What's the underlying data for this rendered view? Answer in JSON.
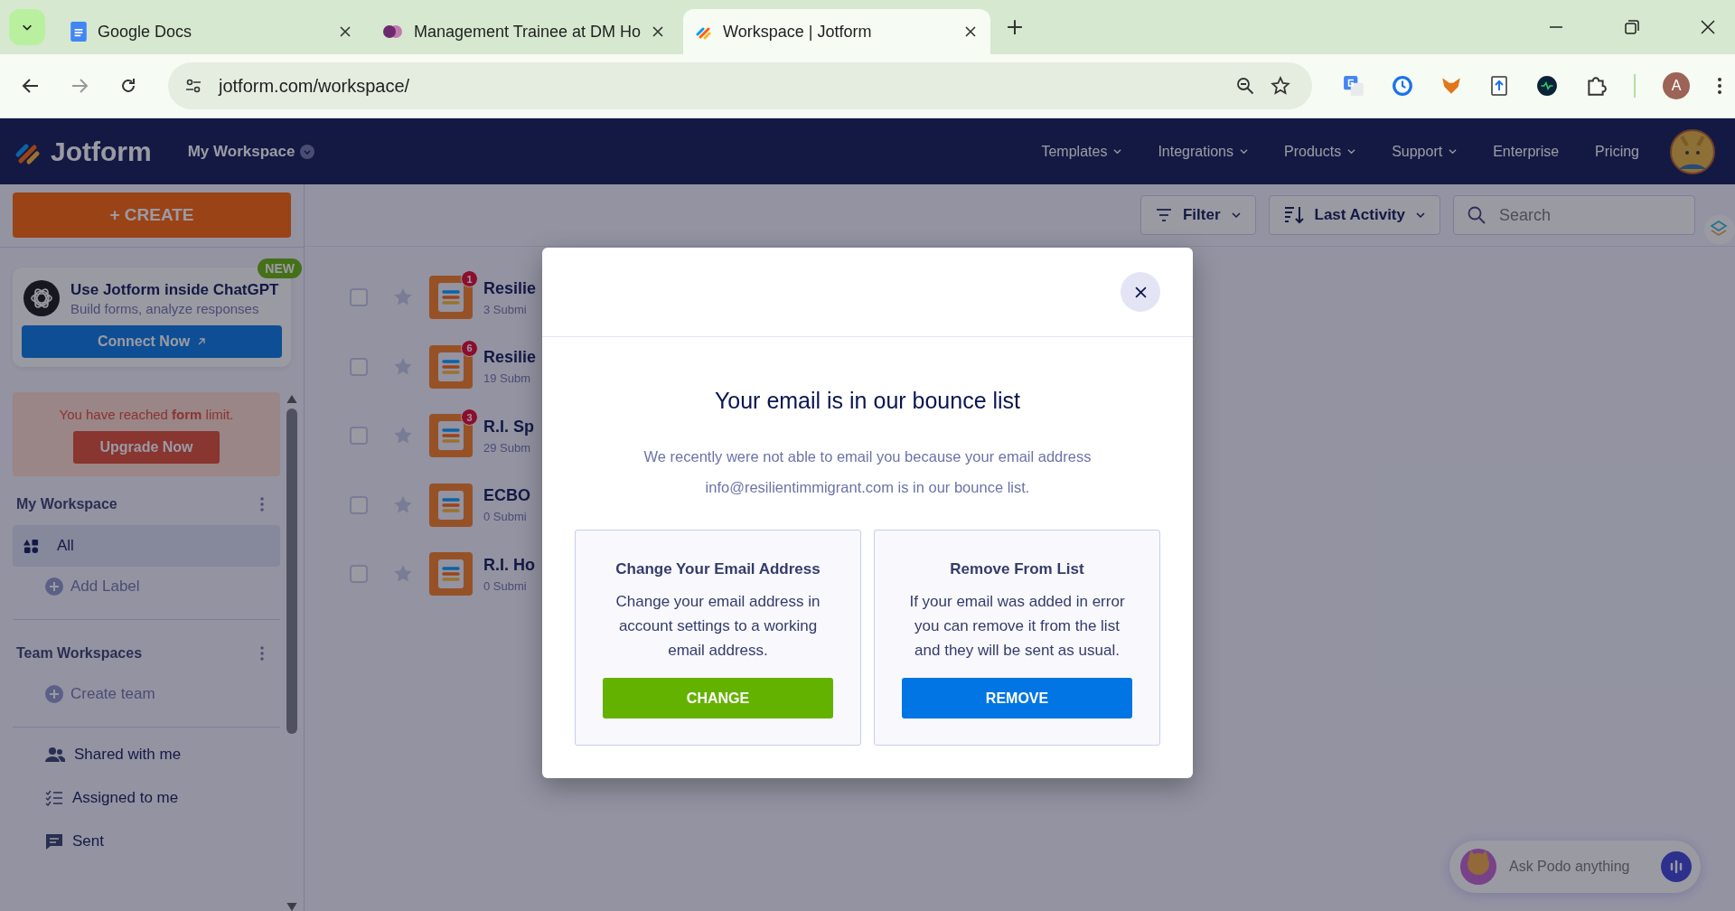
{
  "browser": {
    "tabs": [
      {
        "title": "Google Docs",
        "kind": "docs",
        "selected": false
      },
      {
        "title": "Management Trainee at DM Ho",
        "kind": "teams",
        "selected": false
      },
      {
        "title": "Workspace | Jotform",
        "kind": "jotform",
        "selected": true
      }
    ],
    "address": "jotform.com/workspace/",
    "profile_initial": "A"
  },
  "header": {
    "logo": "Jotform",
    "workspace": "My Workspace",
    "nav": [
      {
        "label": "Templates",
        "has_menu": true
      },
      {
        "label": "Integrations",
        "has_menu": true
      },
      {
        "label": "Products",
        "has_menu": true
      },
      {
        "label": "Support",
        "has_menu": true
      },
      {
        "label": "Enterprise",
        "has_menu": false
      },
      {
        "label": "Pricing",
        "has_menu": false
      }
    ]
  },
  "sidebar": {
    "create_button": "+ CREATE",
    "promo": {
      "badge": "NEW",
      "title": "Use Jotform inside ChatGPT",
      "subtitle": "Build forms, analyze responses",
      "button": "Connect Now"
    },
    "limit": {
      "message": "You have reached **form** limit.",
      "button": "Upgrade Now"
    },
    "my_workspace": {
      "title": "My Workspace",
      "items": [
        {
          "label": "All",
          "selected": true
        }
      ],
      "add_label": "Add Label"
    },
    "team_workspaces": {
      "title": "Team Workspaces",
      "create": "Create team"
    },
    "links": [
      {
        "label": "Shared with me",
        "kind": "shared"
      },
      {
        "label": "Assigned to me",
        "kind": "assigned"
      },
      {
        "label": "Sent",
        "kind": "sent"
      }
    ]
  },
  "toolbar": {
    "filter": "Filter",
    "sort": "Last Activity",
    "search_placeholder": "Search"
  },
  "forms": [
    {
      "title": "Resilie",
      "submissions": "3 Submi",
      "badge": "1",
      "checked": false,
      "starred": false
    },
    {
      "title": "Resilie",
      "submissions": "19 Subm",
      "badge": "6",
      "checked": false,
      "starred": false
    },
    {
      "title": "R.I. Sp",
      "submissions": "29 Subm",
      "badge": "3",
      "checked": false,
      "starred": false
    },
    {
      "title": "ECBO",
      "submissions": "0 Submi",
      "checked": false,
      "starred": false
    },
    {
      "title": "R.I. Ho",
      "submissions": "0 Submi",
      "checked": false,
      "starred": false
    }
  ],
  "modal": {
    "title": "Your email is in our bounce list",
    "message": "We recently were not able to email you because your email address info@resilientimmigrant.com is in our bounce list.",
    "options": [
      {
        "title": "Change Your Email Address",
        "text": "Change your email address in account settings to a working email address.",
        "button": "CHANGE",
        "kind": "change"
      },
      {
        "title": "Remove From List",
        "text": "If your email was added in error you can remove it from the list and they will be sent as usual.",
        "button": "REMOVE",
        "kind": "remove"
      }
    ]
  },
  "assistant": {
    "placeholder": "Ask Podo anything"
  }
}
